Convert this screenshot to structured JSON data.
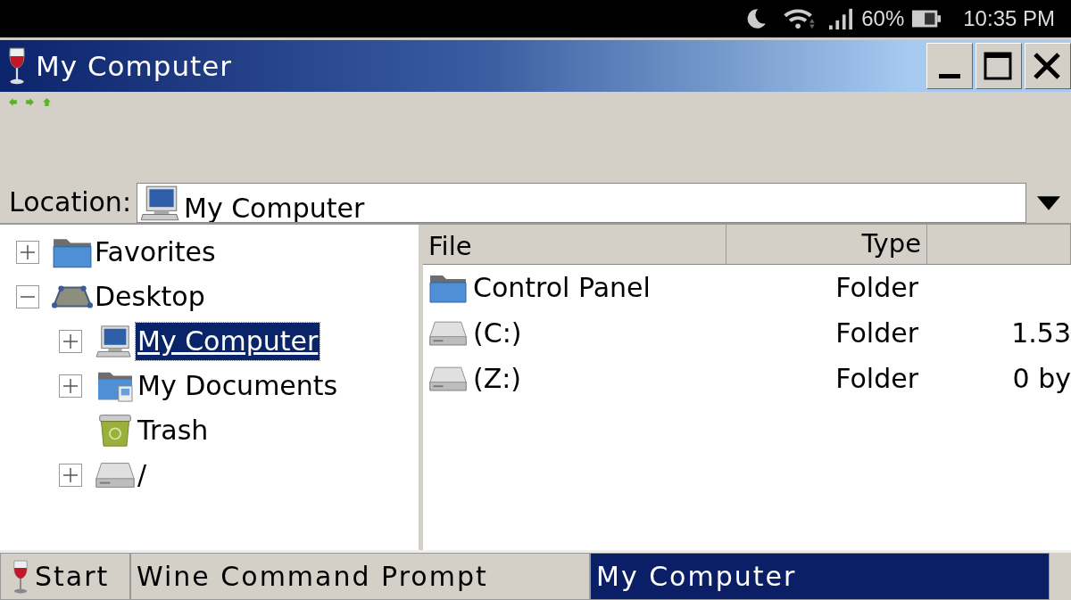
{
  "status_bar": {
    "battery_percent": "60%",
    "time": "10:35 PM"
  },
  "window": {
    "title": "My Computer"
  },
  "toolbar": {
    "buttons": [
      {
        "kind": "back"
      },
      {
        "kind": "forward"
      },
      {
        "kind": "up"
      }
    ]
  },
  "location": {
    "label": "Location:",
    "value": "My Computer"
  },
  "tree": [
    {
      "label": "Favorites",
      "kind": "folder",
      "expanded": false,
      "selected": false
    },
    {
      "label": "Desktop",
      "kind": "desktop",
      "expanded": true,
      "selected": false,
      "children": [
        {
          "label": "My Computer",
          "kind": "computer",
          "expanded": false,
          "selected": true
        },
        {
          "label": "My Documents",
          "kind": "documents",
          "expanded": false,
          "selected": false
        },
        {
          "label": "Trash",
          "kind": "trash",
          "selected": false
        },
        {
          "label": "/",
          "kind": "drive",
          "expanded": false,
          "selected": false
        }
      ]
    }
  ],
  "file_list": {
    "columns": [
      "File",
      "Type"
    ],
    "rows": [
      {
        "kind": "folder",
        "name": "Control Panel",
        "type": "Folder"
      },
      {
        "kind": "drive",
        "name": "(C:)",
        "type": "Folder",
        "column_3": "1.53"
      },
      {
        "kind": "drive",
        "name": "(Z:)",
        "type": "Folder",
        "column_3": "0 by"
      }
    ]
  },
  "taskbar": {
    "start": "Start",
    "tasks": [
      {
        "label": "Wine Command Prompt",
        "selected": false
      },
      {
        "label": "My Computer",
        "selected": true
      }
    ]
  }
}
